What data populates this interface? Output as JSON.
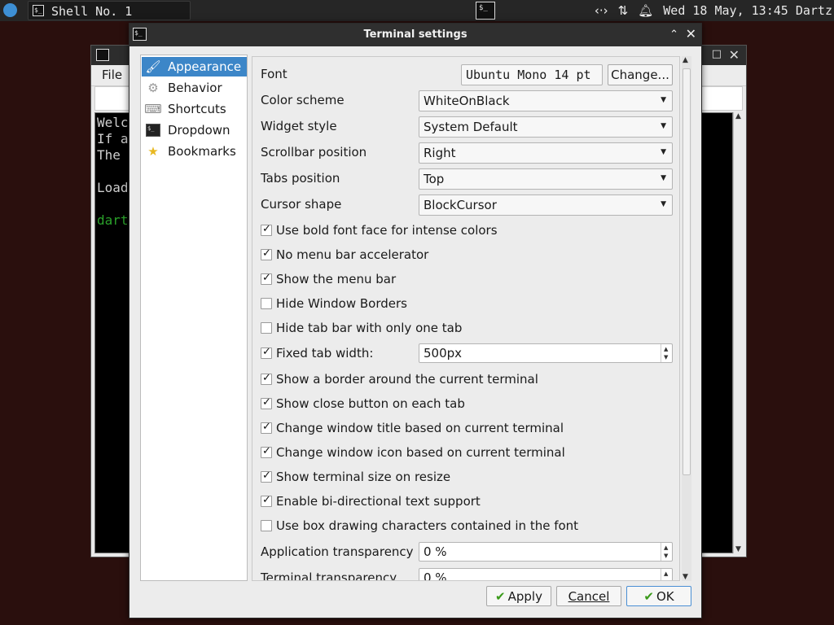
{
  "taskbar": {
    "task_label": "Shell No. 1",
    "clock": "Wed 18 May, 13:45 Dartz"
  },
  "terminal": {
    "menu": [
      "File"
    ],
    "lines": [
      "Welc",
      "If a",
      "The",
      "Load",
      "dart"
    ]
  },
  "dialog": {
    "title": "Terminal settings",
    "nav": [
      {
        "label": "Appearance",
        "icon": "paintbrush-icon",
        "selected": true
      },
      {
        "label": "Behavior",
        "icon": "gear-icon"
      },
      {
        "label": "Shortcuts",
        "icon": "keyboard-icon"
      },
      {
        "label": "Dropdown",
        "icon": "terminal-icon"
      },
      {
        "label": "Bookmarks",
        "icon": "star-add-icon"
      }
    ],
    "font": {
      "label": "Font",
      "value": "Ubuntu Mono 14 pt",
      "change_button": "Change..."
    },
    "combos": {
      "color_scheme": {
        "label": "Color scheme",
        "value": "WhiteOnBlack"
      },
      "widget_style": {
        "label": "Widget style",
        "value": "System Default"
      },
      "scrollbar_position": {
        "label": "Scrollbar position",
        "value": "Right"
      },
      "tabs_position": {
        "label": "Tabs position",
        "value": "Top"
      },
      "cursor_shape": {
        "label": "Cursor shape",
        "value": "BlockCursor"
      }
    },
    "checks": {
      "bold_font": {
        "label": "Use bold font face for intense colors",
        "checked": true
      },
      "no_menu_accel": {
        "label": "No menu bar accelerator",
        "checked": true
      },
      "show_menu_bar": {
        "label": "Show the menu bar",
        "checked": true
      },
      "hide_borders": {
        "label": "Hide Window Borders",
        "checked": false
      },
      "hide_tab_bar": {
        "label": "Hide tab bar with only one tab",
        "checked": false
      },
      "fixed_tab_width": {
        "label": "Fixed tab width:",
        "checked": true
      },
      "border_current": {
        "label": "Show a border around the current terminal",
        "checked": true
      },
      "close_button": {
        "label": "Show close button on each tab",
        "checked": true
      },
      "window_title": {
        "label": "Change window title based on current terminal",
        "checked": true
      },
      "window_icon": {
        "label": "Change window icon based on current terminal",
        "checked": true
      },
      "size_on_resize": {
        "label": "Show terminal size on resize",
        "checked": true
      },
      "bidi": {
        "label": "Enable bi-directional text support",
        "checked": true
      },
      "box_drawing": {
        "label": "Use box drawing characters contained in the font",
        "checked": false
      }
    },
    "fixed_tab_width_value": "500px",
    "app_transparency": {
      "label": "Application transparency",
      "value": "0 %"
    },
    "term_transparency": {
      "label": "Terminal transparency",
      "value": "0 %"
    },
    "buttons": {
      "apply": "Apply",
      "cancel": "Cancel",
      "ok": "OK"
    }
  },
  "colors": {
    "selection": "#3c86c8",
    "taskbar": "#262626",
    "desktop": "#2a0f0d",
    "terminal_green": "#2aa12a"
  }
}
